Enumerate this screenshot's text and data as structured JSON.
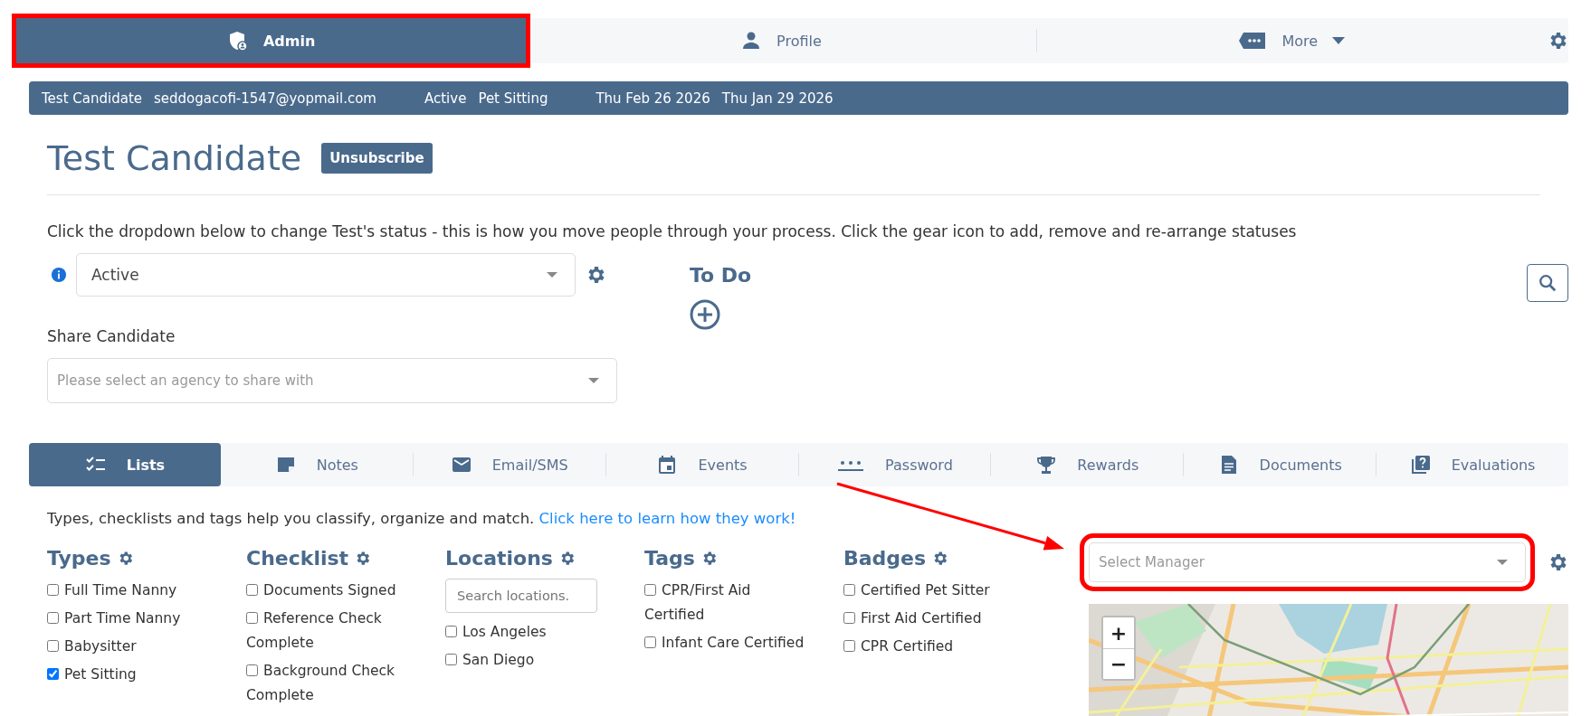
{
  "top_tabs": [
    {
      "label": "Admin",
      "kind": "shield",
      "selected": true,
      "annotated": true
    },
    {
      "label": "Profile",
      "kind": "person",
      "selected": false,
      "annotated": false
    },
    {
      "label": "More",
      "kind": "tag",
      "selected": false,
      "annotated": false,
      "dropdown": true
    }
  ],
  "info_bar": [
    "Test Candidate",
    "seddogacofi-1547@yopmail.com",
    "Active",
    "Pet Sitting",
    "Thu Feb 26 2026",
    "Thu Jan 29 2026"
  ],
  "header": {
    "title": "Test Candidate",
    "button": "Unsubscribe"
  },
  "status_help": "Click the dropdown below to change Test's status - this is how you move people through your process. Click the gear icon to add, remove and re-arrange statuses",
  "status_select": {
    "value": "Active"
  },
  "todo": {
    "title": "To Do"
  },
  "share": {
    "label": "Share Candidate",
    "placeholder": "Please select an agency to share with"
  },
  "section_tabs": [
    {
      "label": "Lists",
      "kind": "checklist",
      "selected": true
    },
    {
      "label": "Notes",
      "kind": "note",
      "selected": false
    },
    {
      "label": "Email/SMS",
      "kind": "mail",
      "selected": false
    },
    {
      "label": "Events",
      "kind": "calendar",
      "selected": false
    },
    {
      "label": "Password",
      "kind": "password",
      "selected": false
    },
    {
      "label": "Rewards",
      "kind": "trophy",
      "selected": false
    },
    {
      "label": "Documents",
      "kind": "document",
      "selected": false
    },
    {
      "label": "Evaluations",
      "kind": "question",
      "selected": false
    }
  ],
  "lists_intro": {
    "text": "Types, checklists and tags help you classify, organize and match.",
    "link": "Click here to learn how they work!"
  },
  "groups": [
    {
      "title": "Types",
      "items": [
        {
          "label": "Full Time Nanny",
          "checked": false
        },
        {
          "label": "Part Time Nanny",
          "checked": false
        },
        {
          "label": "Babysitter",
          "checked": false
        },
        {
          "label": "Pet Sitting",
          "checked": true
        }
      ]
    },
    {
      "title": "Checklist",
      "items": [
        {
          "label": "Documents Signed",
          "checked": false
        },
        {
          "label": "Reference Check Complete",
          "checked": false
        },
        {
          "label": "Background Check Complete",
          "checked": false
        }
      ]
    },
    {
      "title": "Locations",
      "search_placeholder": "Search locations.",
      "items": [
        {
          "label": "Los Angeles",
          "checked": false
        },
        {
          "label": "San Diego",
          "checked": false
        }
      ]
    },
    {
      "title": "Tags",
      "items": [
        {
          "label": "CPR/First Aid Certified",
          "checked": false
        },
        {
          "label": "Infant Care Certified",
          "checked": false
        }
      ]
    },
    {
      "title": "Badges",
      "items": [
        {
          "label": "Certified Pet Sitter",
          "checked": false
        },
        {
          "label": "First Aid Certified",
          "checked": false
        },
        {
          "label": "CPR Certified",
          "checked": false
        }
      ]
    }
  ],
  "manager_select": {
    "placeholder": "Select Manager",
    "annotated": true
  },
  "map": {
    "kind": "picture",
    "zoom_in": "+",
    "zoom_out": "−"
  }
}
